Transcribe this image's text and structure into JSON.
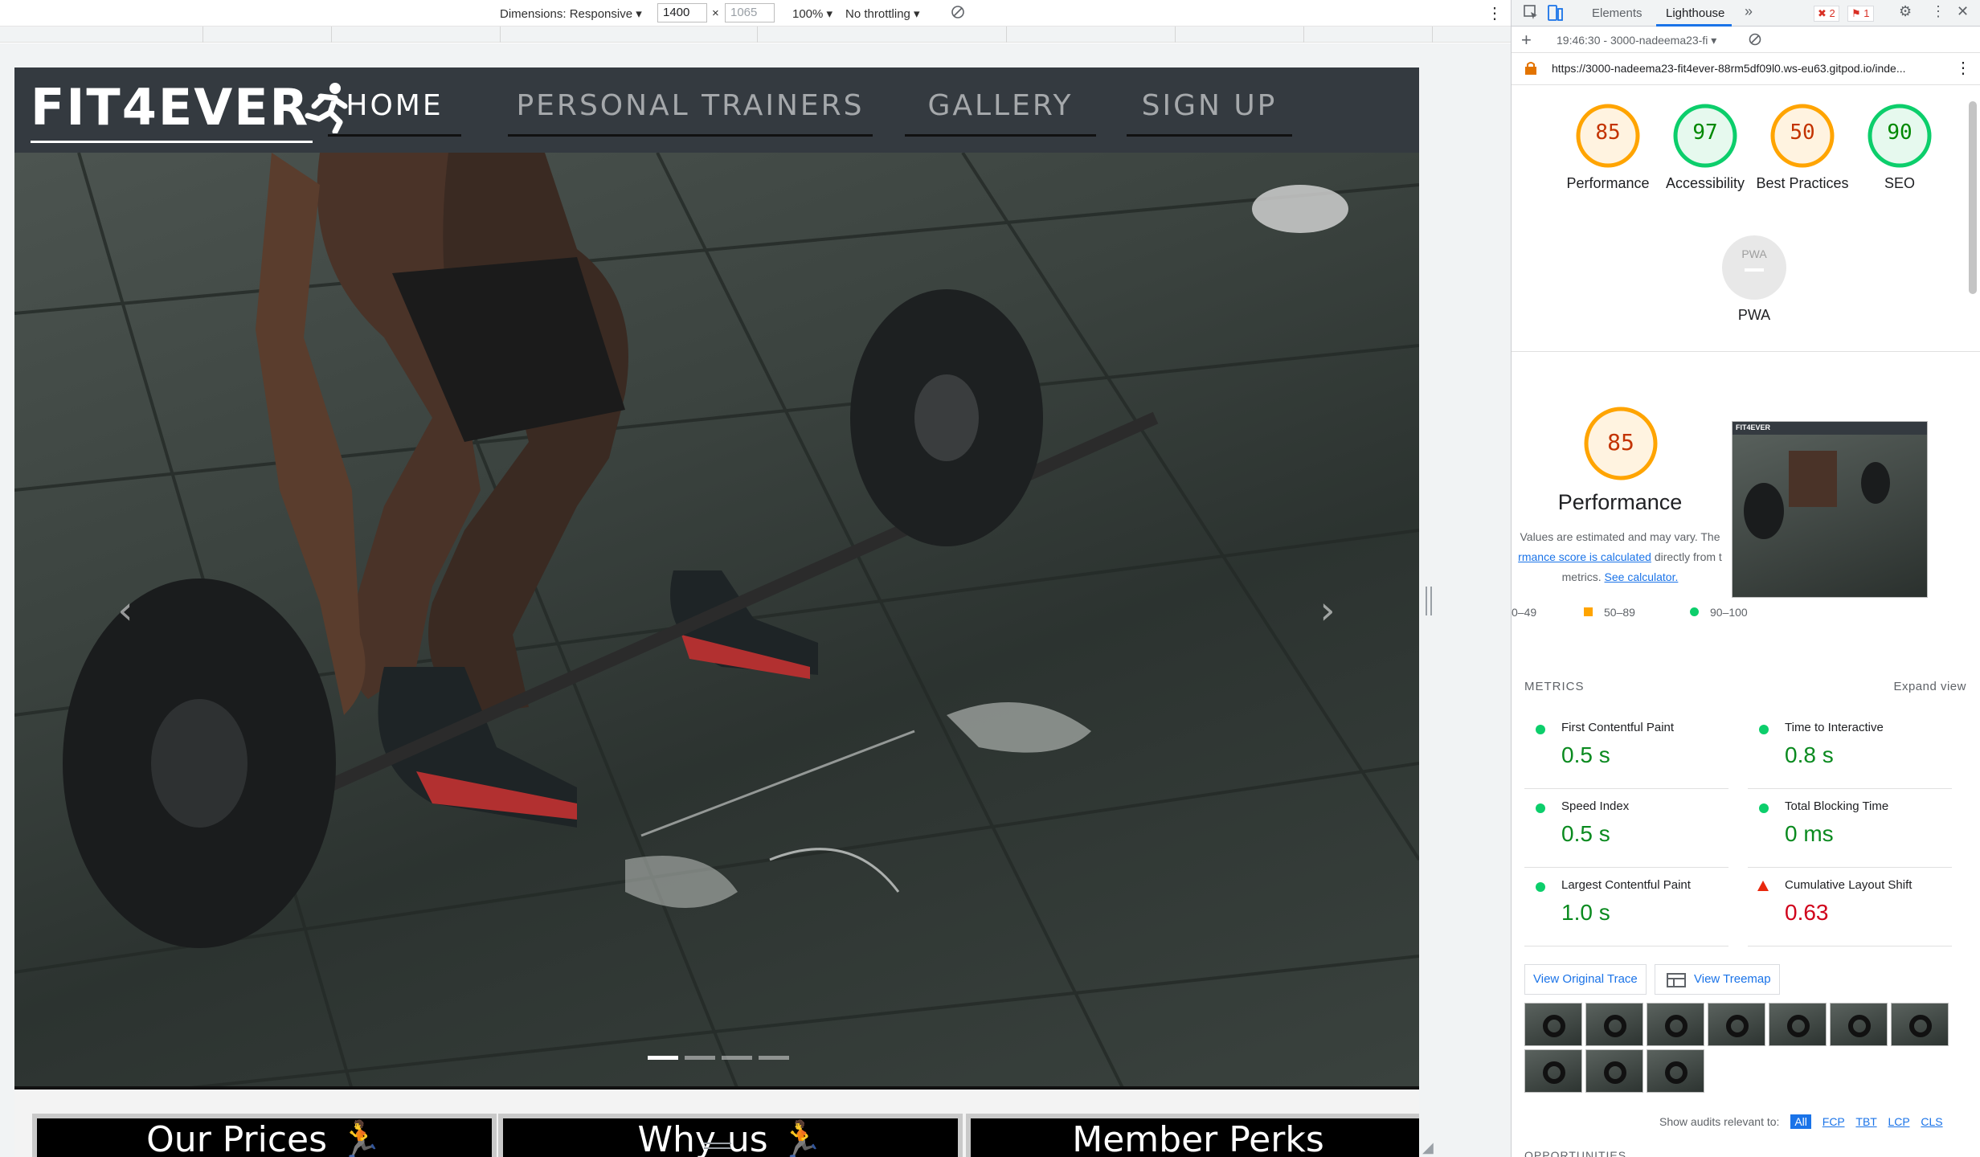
{
  "device_toolbar": {
    "dimensions_label": "Dimensions: Responsive",
    "width_value": "1400",
    "times_sign": "×",
    "height_placeholder": "1065",
    "zoom": "100%",
    "throttling": "No throttling"
  },
  "site": {
    "brand": "FIT4EVER",
    "nav": [
      {
        "label": "HOME"
      },
      {
        "label": "PERSONAL TRAINERS"
      },
      {
        "label": "GALLERY"
      },
      {
        "label": "SIGN UP"
      }
    ],
    "carousel_slides": 4,
    "carousel_active_index": 0,
    "cards": [
      {
        "title": "Our Prices"
      },
      {
        "title": "Why us"
      },
      {
        "title": "Member Perks"
      }
    ]
  },
  "devtools": {
    "tabs": [
      {
        "label": "Elements"
      },
      {
        "label": "Lighthouse"
      }
    ],
    "error_count": "2",
    "issue_count": "1",
    "report_selector": "19:46:30 - 3000-nadeema23-fi",
    "url": "https://3000-nadeema23-fit4ever-88rm5df09l0.ws-eu63.gitpod.io/inde...",
    "scores": [
      {
        "label": "Performance",
        "score": "85",
        "color": "#ffa400"
      },
      {
        "label": "Accessibility",
        "score": "97",
        "color": "#0cce6b"
      },
      {
        "label": "Best Practices",
        "score": "50",
        "color": "#ffa400"
      },
      {
        "label": "SEO",
        "score": "90",
        "color": "#0cce6b"
      }
    ],
    "pwa": {
      "label": "PWA",
      "badge": "PWA"
    },
    "performance": {
      "score": "85",
      "title": "Performance",
      "note_line1": "Values are estimated and may vary. The",
      "note_link": "rmance score is calculated",
      "note_line2_rest": "directly from t",
      "note_line3": "metrics.",
      "calc_link": "See calculator.",
      "legend": [
        {
          "label": "0–49"
        },
        {
          "label": "50–89"
        },
        {
          "label": "90–100"
        }
      ]
    },
    "metrics_heading": "METRICS",
    "expand_view": "Expand view",
    "metrics": [
      {
        "name": "First Contentful Paint",
        "value": "0.5 s",
        "status": "pass"
      },
      {
        "name": "Time to Interactive",
        "value": "0.8 s",
        "status": "pass"
      },
      {
        "name": "Speed Index",
        "value": "0.5 s",
        "status": "pass"
      },
      {
        "name": "Total Blocking Time",
        "value": "0 ms",
        "status": "pass"
      },
      {
        "name": "Largest Contentful Paint",
        "value": "1.0 s",
        "status": "pass"
      },
      {
        "name": "Cumulative Layout Shift",
        "value": "0.63",
        "status": "fail"
      }
    ],
    "view_trace": "View Original Trace",
    "view_treemap": "View Treemap",
    "filter_label": "Show audits relevant to:",
    "filters": [
      {
        "label": "All"
      },
      {
        "label": "FCP"
      },
      {
        "label": "TBT"
      },
      {
        "label": "LCP"
      },
      {
        "label": "CLS"
      }
    ],
    "opportunities": "OPPORTUNITIES"
  }
}
